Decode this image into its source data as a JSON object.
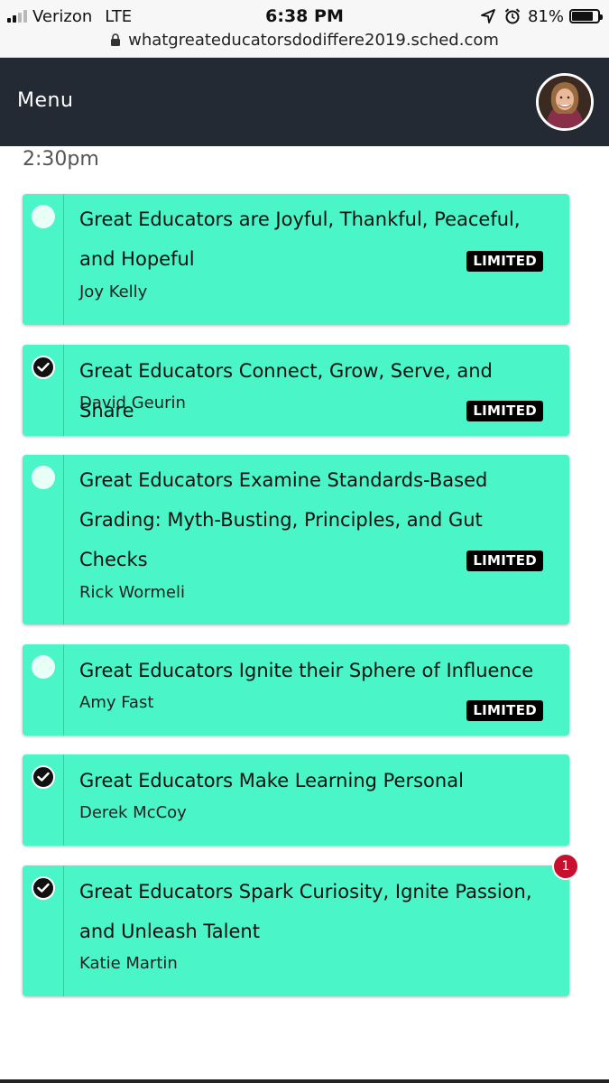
{
  "status_bar": {
    "carrier": "Verizon",
    "network": "LTE",
    "time": "6:38 PM",
    "battery_percent": "81%",
    "battery_level": 0.81,
    "url": "whatgreateducatorsdodiffere2019.sched.com"
  },
  "header": {
    "menu_label": "Menu"
  },
  "schedule": {
    "time_slot": "2:30pm",
    "badge_text": "LIMITED",
    "sessions": [
      {
        "title": "Great Educators are Joyful, Thankful, Peaceful, and Hopeful",
        "speaker": "Joy Kelly",
        "selected": false,
        "limited": true
      },
      {
        "title": "Great Educators Connect, Grow, Serve, and Share",
        "speaker": "David Geurin",
        "selected": true,
        "limited": true
      },
      {
        "title": "Great Educators Examine Standards-Based Grading: Myth-Busting, Principles, and Gut Checks",
        "speaker": "Rick Wormeli",
        "selected": false,
        "limited": true
      },
      {
        "title": "Great Educators Ignite their Sphere of Influence",
        "speaker": "Amy Fast",
        "selected": false,
        "limited": true
      },
      {
        "title": "Great Educators Make Learning Personal",
        "speaker": "Derek McCoy",
        "selected": true,
        "limited": false
      },
      {
        "title": "Great Educators Spark Curiosity, Ignite Passion, and Unleash Talent",
        "speaker": "Katie Martin",
        "selected": true,
        "limited": false
      }
    ],
    "notification_count": "1"
  },
  "colors": {
    "card": "#4af5c8",
    "header": "#232a33",
    "badge": "#000000",
    "notification": "#c8102e"
  }
}
